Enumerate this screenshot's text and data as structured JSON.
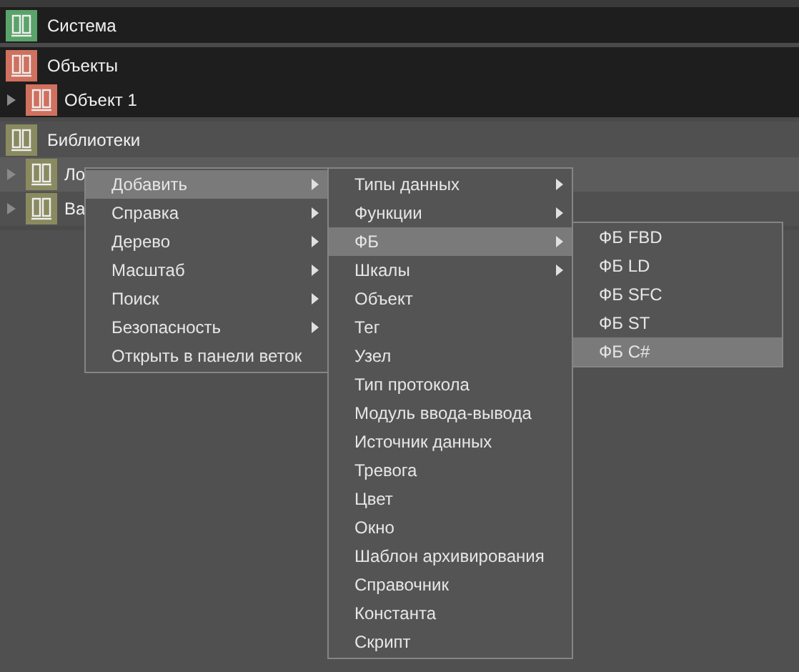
{
  "tree": [
    {
      "label": "Система",
      "color": "#5aa36a"
    },
    {
      "label": "Объекты",
      "color": "#d0705e",
      "children": [
        {
          "label": "Объект 1",
          "color": "#d0705e",
          "selected": false
        }
      ]
    },
    {
      "label": "Библиотеки",
      "color": "#8a8a60",
      "children": [
        {
          "label": "Ло",
          "color": "#8a8a60",
          "selected": true
        },
        {
          "label": "Ba",
          "color": "#8a8a60",
          "selected": false
        }
      ]
    }
  ],
  "context_menu": [
    {
      "label": "Добавить",
      "kind": "submenu",
      "selected": true
    },
    {
      "label": "Справка",
      "kind": "submenu",
      "selected": false
    },
    {
      "label": "Дерево",
      "kind": "submenu",
      "selected": false
    },
    {
      "label": "Масштаб",
      "kind": "submenu",
      "selected": false
    },
    {
      "label": "Поиск",
      "kind": "submenu",
      "selected": false
    },
    {
      "label": "Безопасность",
      "kind": "submenu",
      "selected": false
    },
    {
      "label": "Открыть в панели веток",
      "kind": "action",
      "selected": false
    }
  ],
  "add_submenu": [
    {
      "label": "Типы данных",
      "kind": "submenu",
      "selected": false
    },
    {
      "label": "Функции",
      "kind": "submenu",
      "selected": false
    },
    {
      "label": "ФБ",
      "kind": "submenu",
      "selected": true
    },
    {
      "label": "Шкалы",
      "kind": "submenu",
      "selected": false
    },
    {
      "label": "Объект",
      "kind": "action",
      "selected": false
    },
    {
      "label": "Тег",
      "kind": "action",
      "selected": false
    },
    {
      "label": "Узел",
      "kind": "action",
      "selected": false
    },
    {
      "label": "Тип протокола",
      "kind": "action",
      "selected": false
    },
    {
      "label": "Модуль ввода-вывода",
      "kind": "action",
      "selected": false
    },
    {
      "label": "Источник данных",
      "kind": "action",
      "selected": false
    },
    {
      "label": "Тревога",
      "kind": "action",
      "selected": false
    },
    {
      "label": "Цвет",
      "kind": "action",
      "selected": false
    },
    {
      "label": "Окно",
      "kind": "action",
      "selected": false
    },
    {
      "label": "Шаблон архивирования",
      "kind": "action",
      "selected": false
    },
    {
      "label": "Справочник",
      "kind": "action",
      "selected": false
    },
    {
      "label": "Константа",
      "kind": "action",
      "selected": false
    },
    {
      "label": "Скрипт",
      "kind": "action",
      "selected": false
    }
  ],
  "fb_submenu": [
    {
      "label": "ФБ FBD",
      "selected": false
    },
    {
      "label": "ФБ LD",
      "selected": false
    },
    {
      "label": "ФБ SFC",
      "selected": false
    },
    {
      "label": "ФБ ST",
      "selected": false
    },
    {
      "label": "ФБ C#",
      "selected": true
    }
  ]
}
